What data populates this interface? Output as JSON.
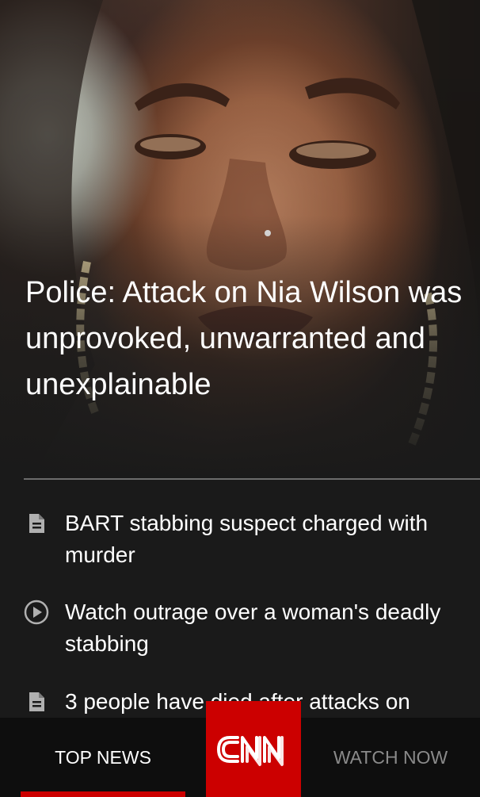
{
  "hero": {
    "headline": "Police: Attack on Nia Wilson was unprovoked, unwarranted and unexplainable"
  },
  "related": [
    {
      "icon": "document-icon",
      "text": "BART stabbing suspect charged with murder"
    },
    {
      "icon": "play-circle-icon",
      "text": "Watch outrage over a woman's deadly stabbing"
    },
    {
      "icon": "document-icon",
      "text": "3 people have died after attacks on"
    }
  ],
  "tabbar": {
    "tabs": [
      {
        "label": "TOP NEWS",
        "active": true
      },
      {
        "label": "WATCH NOW",
        "active": false
      }
    ],
    "logo": "CNN",
    "accent_color": "#cc0000"
  }
}
